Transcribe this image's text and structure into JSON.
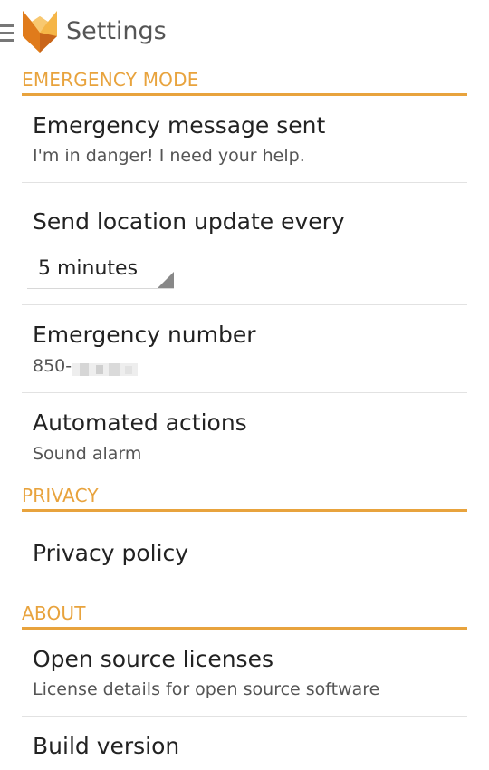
{
  "actionbar": {
    "title": "Settings",
    "drawer_icon": "menu-icon",
    "logo_icon": "fox-logo-icon"
  },
  "colors": {
    "accent": "#e8a33d",
    "logo_dark": "#e07b1b",
    "logo_light": "#f5b547"
  },
  "sections": {
    "emergency": {
      "header": "EMERGENCY MODE",
      "message": {
        "title": "Emergency message sent",
        "summary": "I'm in danger! I need your help."
      },
      "location": {
        "title": "Send location update every",
        "value": "5 minutes"
      },
      "number": {
        "title": "Emergency number",
        "summary_prefix": "850-"
      },
      "actions": {
        "title": "Automated actions",
        "summary": "Sound alarm"
      }
    },
    "privacy": {
      "header": "PRIVACY",
      "policy": {
        "title": "Privacy policy"
      }
    },
    "about": {
      "header": "ABOUT",
      "licenses": {
        "title": "Open source licenses",
        "summary": "License details for open source software"
      },
      "build": {
        "title": "Build version"
      }
    }
  }
}
